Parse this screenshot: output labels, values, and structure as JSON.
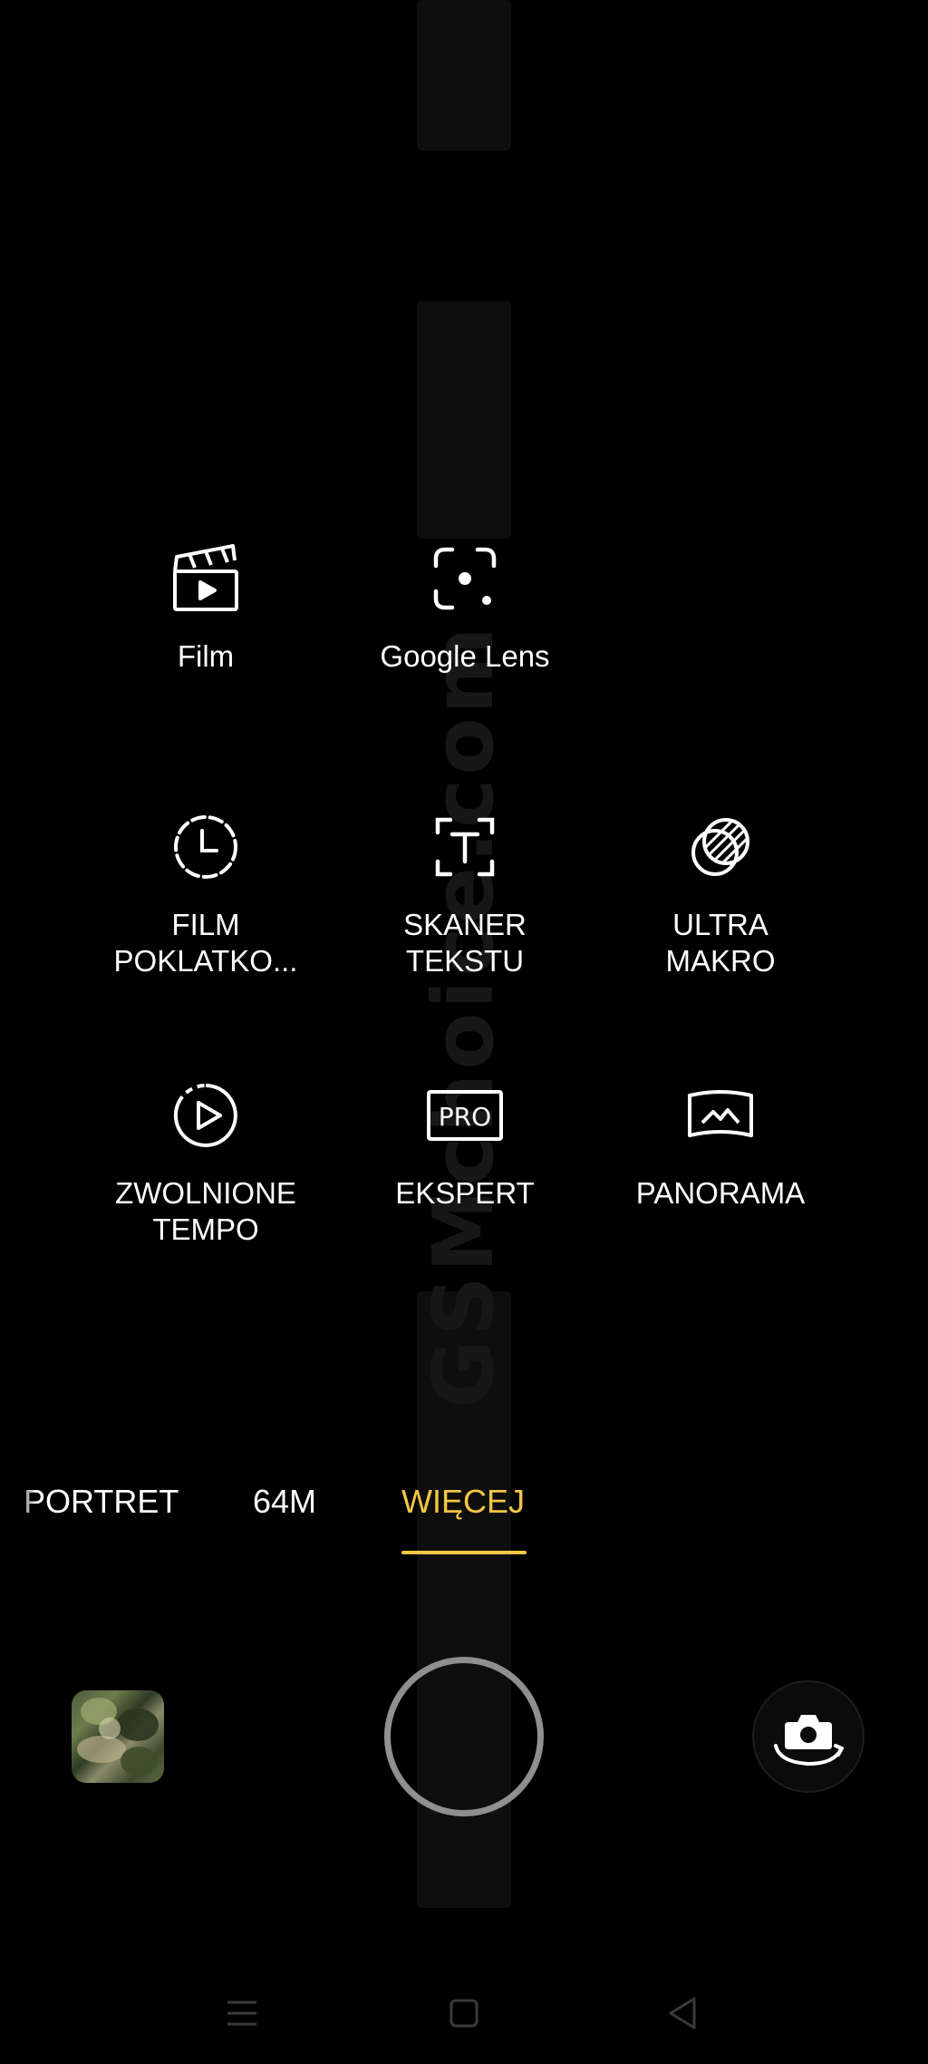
{
  "watermark": {
    "text": "GSMchoice.com"
  },
  "modes": [
    {
      "id": "film",
      "label": "Film",
      "icon": "clapperboard-icon"
    },
    {
      "id": "google-lens",
      "label": "Google Lens",
      "icon": "lens-icon"
    },
    {
      "id": "timelapse",
      "label": "FILM\nPOKLATKO...",
      "icon": "timer-dashed-icon"
    },
    {
      "id": "text-scanner",
      "label": "SKANER\nTEKSTU",
      "icon": "text-scan-icon"
    },
    {
      "id": "ultra-macro",
      "label": "ULTRA\nMAKRO",
      "icon": "macro-icon"
    },
    {
      "id": "slow-motion",
      "label": "ZWOLNIONE\nTEMPO",
      "icon": "slow-motion-icon"
    },
    {
      "id": "expert",
      "label": "EKSPERT",
      "icon": "pro-icon"
    },
    {
      "id": "panorama",
      "label": "PANORAMA",
      "icon": "panorama-icon"
    }
  ],
  "mode_tabs": [
    {
      "label": "PORTRET",
      "active": false
    },
    {
      "label": "64M",
      "active": false
    },
    {
      "label": "WIĘCEJ",
      "active": true
    }
  ],
  "colors": {
    "background": "#000000",
    "accent": "#f5c643",
    "text": "#ffffff",
    "shutter_ring": "#8f8f8f"
  },
  "controls": {
    "gallery": "gallery-thumbnail",
    "shutter": "shutter-button",
    "switch_camera": "switch-camera-icon"
  },
  "nav": {
    "menu": "menu-icon",
    "home": "home-icon",
    "back": "back-icon"
  }
}
